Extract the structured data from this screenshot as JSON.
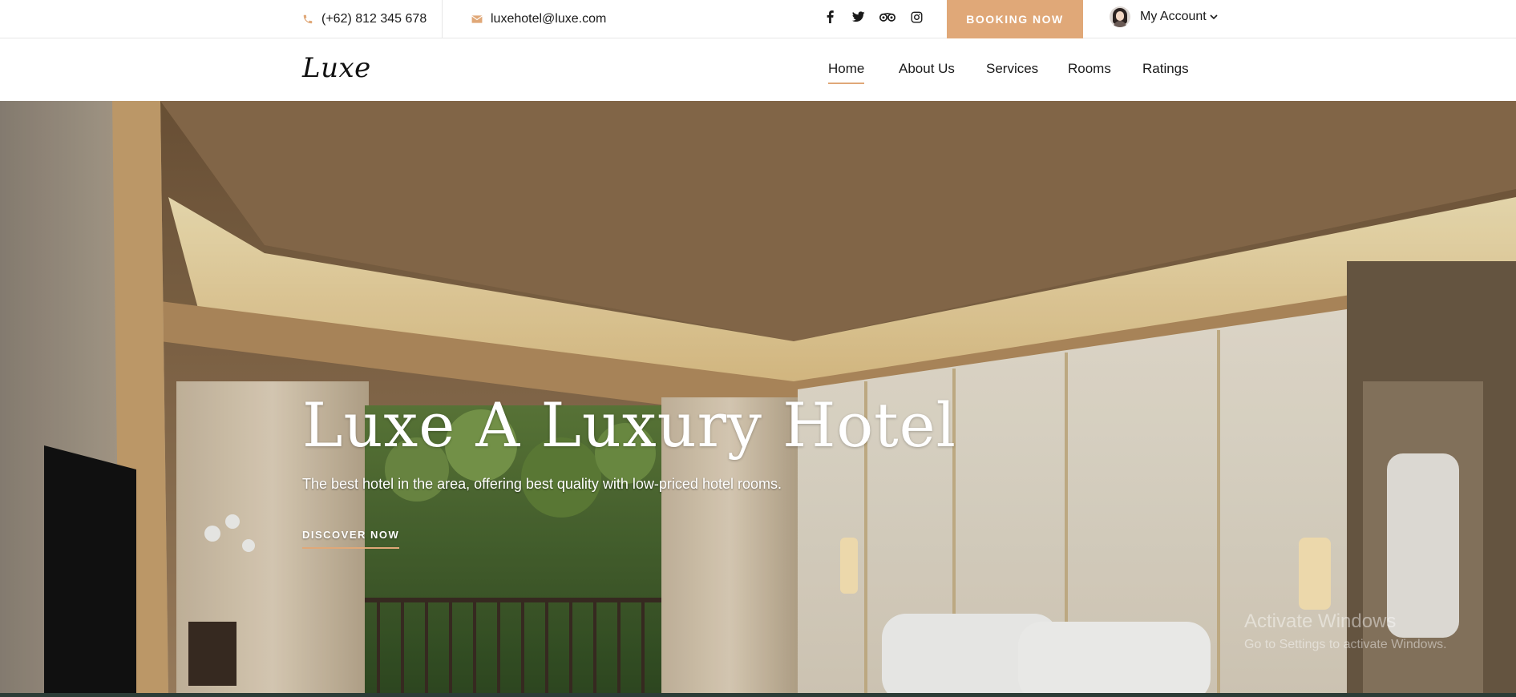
{
  "topbar": {
    "phone": "(+62) 812 345 678",
    "email": "luxehotel@luxe.com",
    "social_icons": [
      "facebook-icon",
      "twitter-icon",
      "tripadvisor-icon",
      "instagram-icon"
    ],
    "booking_label": "BOOKING NOW",
    "account_label": "My Account"
  },
  "nav": {
    "logo": "Luxe",
    "links": [
      {
        "label": "Home",
        "active": true
      },
      {
        "label": "About Us",
        "active": false
      },
      {
        "label": "Services",
        "active": false
      },
      {
        "label": "Rooms",
        "active": false
      },
      {
        "label": "Ratings",
        "active": false
      }
    ]
  },
  "hero": {
    "title": "Luxe A Luxury Hotel",
    "subtitle": "The best hotel in the area, offering best quality with low-priced hotel rooms.",
    "cta_label": "DISCOVER NOW"
  },
  "overlay": {
    "activate_title": "Activate Windows",
    "activate_sub": "Go to Settings to activate Windows."
  },
  "colors": {
    "accent": "#e0a878",
    "text": "#1a1a1a",
    "bottom_strip": "#2c3c36"
  }
}
